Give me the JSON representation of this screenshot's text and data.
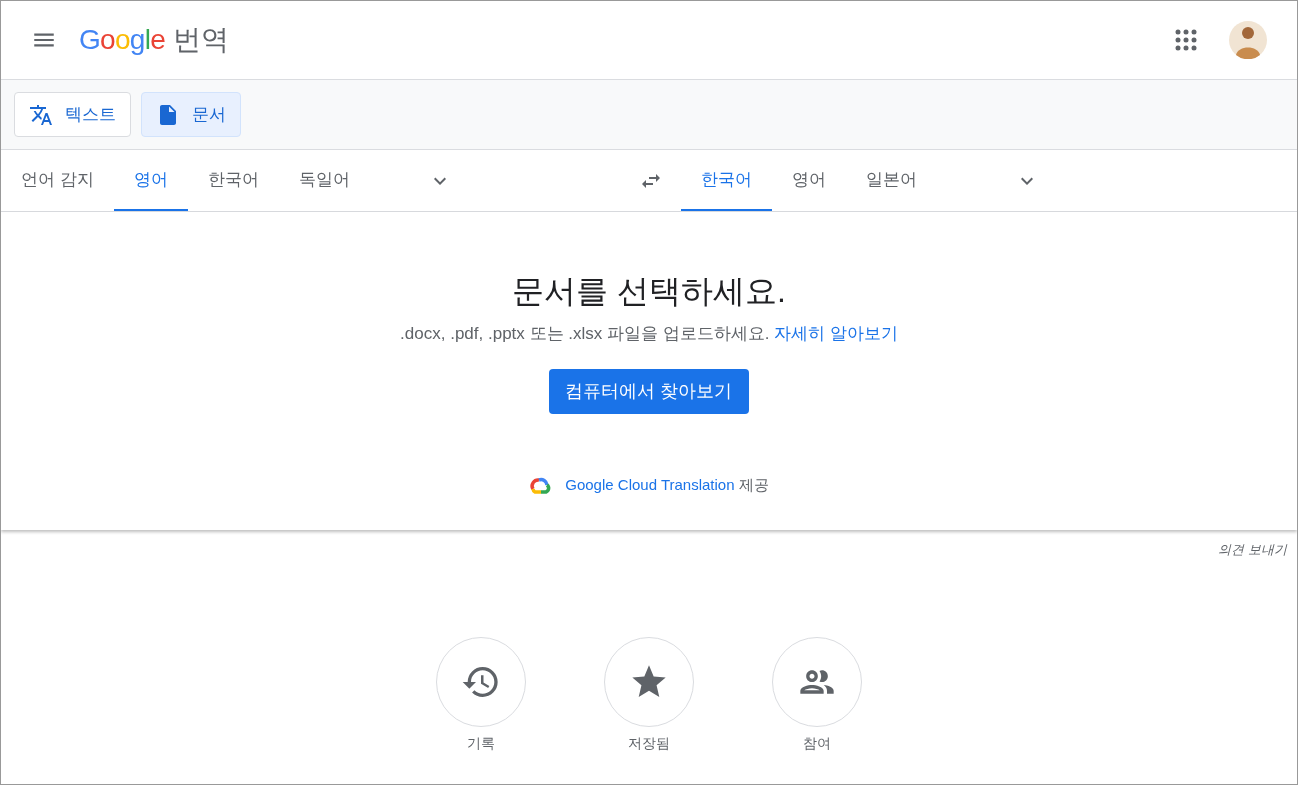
{
  "header": {
    "logo": "Google",
    "product": "번역"
  },
  "modes": [
    {
      "label": "텍스트",
      "kind": "text",
      "selected": false
    },
    {
      "label": "문서",
      "kind": "document",
      "selected": true
    }
  ],
  "source_languages": [
    {
      "label": "언어 감지",
      "selected": false
    },
    {
      "label": "영어",
      "selected": true
    },
    {
      "label": "한국어",
      "selected": false
    },
    {
      "label": "독일어",
      "selected": false
    }
  ],
  "target_languages": [
    {
      "label": "한국어",
      "selected": true
    },
    {
      "label": "영어",
      "selected": false
    },
    {
      "label": "일본어",
      "selected": false
    }
  ],
  "document_panel": {
    "title": "문서를 선택하세요.",
    "description": ".docx, .pdf, .pptx 또는 .xlsx 파일을 업로드하세요.",
    "learn_more": "자세히 알아보기",
    "browse_button": "컴퓨터에서 찾아보기",
    "powered_by_link": "Google Cloud Translation",
    "powered_by_suffix": "제공"
  },
  "feedback": "의견 보내기",
  "shortcuts": [
    {
      "kind": "history",
      "label": "기록"
    },
    {
      "kind": "saved",
      "label": "저장됨"
    },
    {
      "kind": "community",
      "label": "참여"
    }
  ]
}
